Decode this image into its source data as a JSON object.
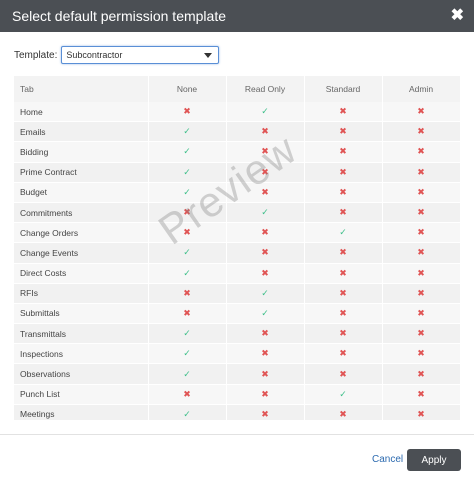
{
  "dialog": {
    "title": "Select default permission template",
    "close_icon": "close-icon"
  },
  "template": {
    "label": "Template:",
    "value": "Subcontractor"
  },
  "table": {
    "headers": [
      "Tab",
      "None",
      "Read Only",
      "Standard",
      "Admin"
    ],
    "rows": [
      {
        "tab": "Home",
        "levels": [
          "no",
          "yes",
          "no",
          "no"
        ]
      },
      {
        "tab": "Emails",
        "levels": [
          "yes",
          "no",
          "no",
          "no"
        ]
      },
      {
        "tab": "Bidding",
        "levels": [
          "yes",
          "no",
          "no",
          "no"
        ]
      },
      {
        "tab": "Prime Contract",
        "levels": [
          "yes",
          "no",
          "no",
          "no"
        ]
      },
      {
        "tab": "Budget",
        "levels": [
          "yes",
          "no",
          "no",
          "no"
        ]
      },
      {
        "tab": "Commitments",
        "levels": [
          "no",
          "yes",
          "no",
          "no"
        ]
      },
      {
        "tab": "Change Orders",
        "levels": [
          "no",
          "no",
          "yes",
          "no"
        ]
      },
      {
        "tab": "Change Events",
        "levels": [
          "yes",
          "no",
          "no",
          "no"
        ]
      },
      {
        "tab": "Direct Costs",
        "levels": [
          "yes",
          "no",
          "no",
          "no"
        ]
      },
      {
        "tab": "RFIs",
        "levels": [
          "no",
          "yes",
          "no",
          "no"
        ]
      },
      {
        "tab": "Submittals",
        "levels": [
          "no",
          "yes",
          "no",
          "no"
        ]
      },
      {
        "tab": "Transmittals",
        "levels": [
          "yes",
          "no",
          "no",
          "no"
        ]
      },
      {
        "tab": "Inspections",
        "levels": [
          "yes",
          "no",
          "no",
          "no"
        ]
      },
      {
        "tab": "Observations",
        "levels": [
          "yes",
          "no",
          "no",
          "no"
        ]
      },
      {
        "tab": "Punch List",
        "levels": [
          "no",
          "no",
          "yes",
          "no"
        ]
      },
      {
        "tab": "Meetings",
        "levels": [
          "yes",
          "no",
          "no",
          "no"
        ]
      }
    ]
  },
  "watermark": "Preview",
  "footer": {
    "cancel_label": "Cancel",
    "apply_label": "Apply"
  },
  "colors": {
    "header_bg": "#4b4f54",
    "yes": "#3fbf8a",
    "no": "#e05454",
    "link": "#2d6bb0"
  },
  "icons": {
    "yes": "check-icon",
    "no": "x-icon"
  }
}
